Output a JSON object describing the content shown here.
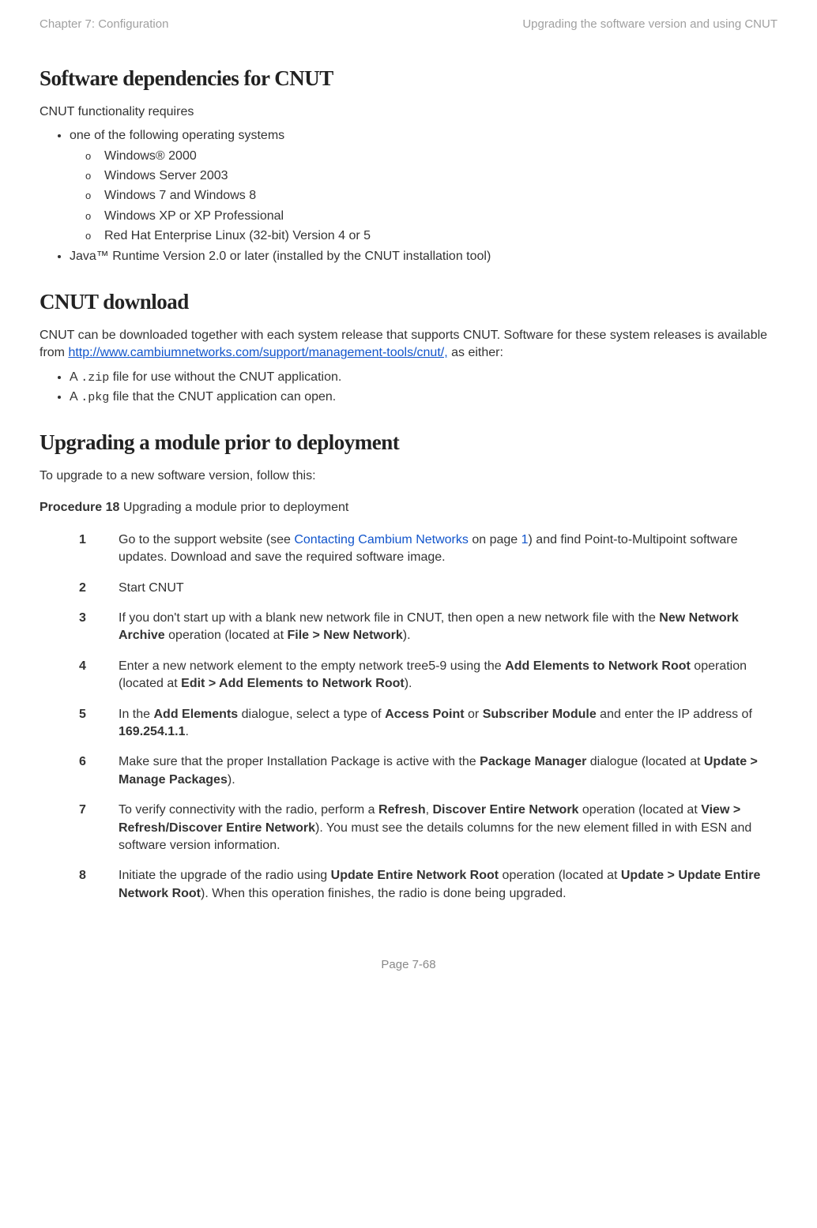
{
  "header": {
    "left": "Chapter 7:  Configuration",
    "right": "Upgrading the software version and using CNUT"
  },
  "sec1": {
    "title": "Software dependencies for CNUT",
    "intro": "CNUT functionality requires",
    "b1": "one of the following operating systems",
    "os1": "Windows® 2000",
    "os2": "Windows Server 2003",
    "os3": "Windows 7 and Windows 8",
    "os4": "Windows XP or XP Professional",
    "os5": "Red Hat Enterprise Linux (32-bit) Version 4 or 5",
    "b2": "Java™ Runtime Version 2.0 or later (installed by the CNUT installation tool)"
  },
  "sec2": {
    "title": "CNUT download",
    "p1_a": "CNUT can be downloaded together with each system release that supports CNUT. Software for these system releases is available from ",
    "p1_link": "http://www.cambiumnetworks.com/support/management-tools/cnut/,",
    "p1_b": " as either:",
    "li1_a": "A ",
    "li1_code": ".zip",
    "li1_b": " file for use without the CNUT application.",
    "li2_a": "A ",
    "li2_code": ".pkg",
    "li2_b": " file that the CNUT application can open."
  },
  "sec3": {
    "title": "Upgrading a module prior to deployment",
    "intro": "To upgrade to a new software version, follow this:",
    "proc_label": "Procedure 18",
    "proc_title": " Upgrading a module prior to deployment",
    "steps": {
      "n1": "1",
      "s1_a": "Go to the support website (see ",
      "s1_link": "Contacting Cambium Networks",
      "s1_b": " on page ",
      "s1_page": "1",
      "s1_c": ") and find Point-to-Multipoint software updates. Download and save the required software image.",
      "n2": "2",
      "s2": "Start CNUT",
      "n3": "3",
      "s3_a": "If you don't start up with a blank new network file in CNUT, then open a new network file with the ",
      "s3_b1": "New Network Archive",
      "s3_b": " operation (located at ",
      "s3_b2": "File > New Network",
      "s3_c": ").",
      "n4": "4",
      "s4_a": "Enter a new network element to the empty network tree5-9 using the ",
      "s4_b1": "Add Elements to Network Root",
      "s4_b": " operation (located at ",
      "s4_b2": "Edit > Add Elements to Network Root",
      "s4_c": ").",
      "n5": "5",
      "s5_a": "In the ",
      "s5_b1": "Add Elements",
      "s5_b": " dialogue, select a type of ",
      "s5_b2": "Access Point",
      "s5_c": " or ",
      "s5_b3": "Subscriber Module",
      "s5_d": " and enter the IP address of ",
      "s5_b4": "169.254.1.1",
      "s5_e": ".",
      "n6": "6",
      "s6_a": "Make sure that the proper Installation Package is active with the ",
      "s6_b1": "Package Manager",
      "s6_b": " dialogue (located at ",
      "s6_b2": "Update > Manage Packages",
      "s6_c": ").",
      "n7": "7",
      "s7_a": "To verify connectivity with the radio, perform a ",
      "s7_b1": "Refresh",
      "s7_b": ", ",
      "s7_b2": "Discover Entire Network",
      "s7_c": " operation (located at ",
      "s7_b3": "View > Refresh/Discover Entire Network",
      "s7_d": "). You must see the details columns for the new element filled in with ESN and software version information.",
      "n8": "8",
      "s8_a": "Initiate the upgrade of the radio using ",
      "s8_b1": "Update Entire Network Root",
      "s8_b": " operation (located at ",
      "s8_b2": "Update > Update Entire Network Root",
      "s8_c": "). When this operation finishes, the radio is done being upgraded."
    }
  },
  "footer": "Page 7-68"
}
